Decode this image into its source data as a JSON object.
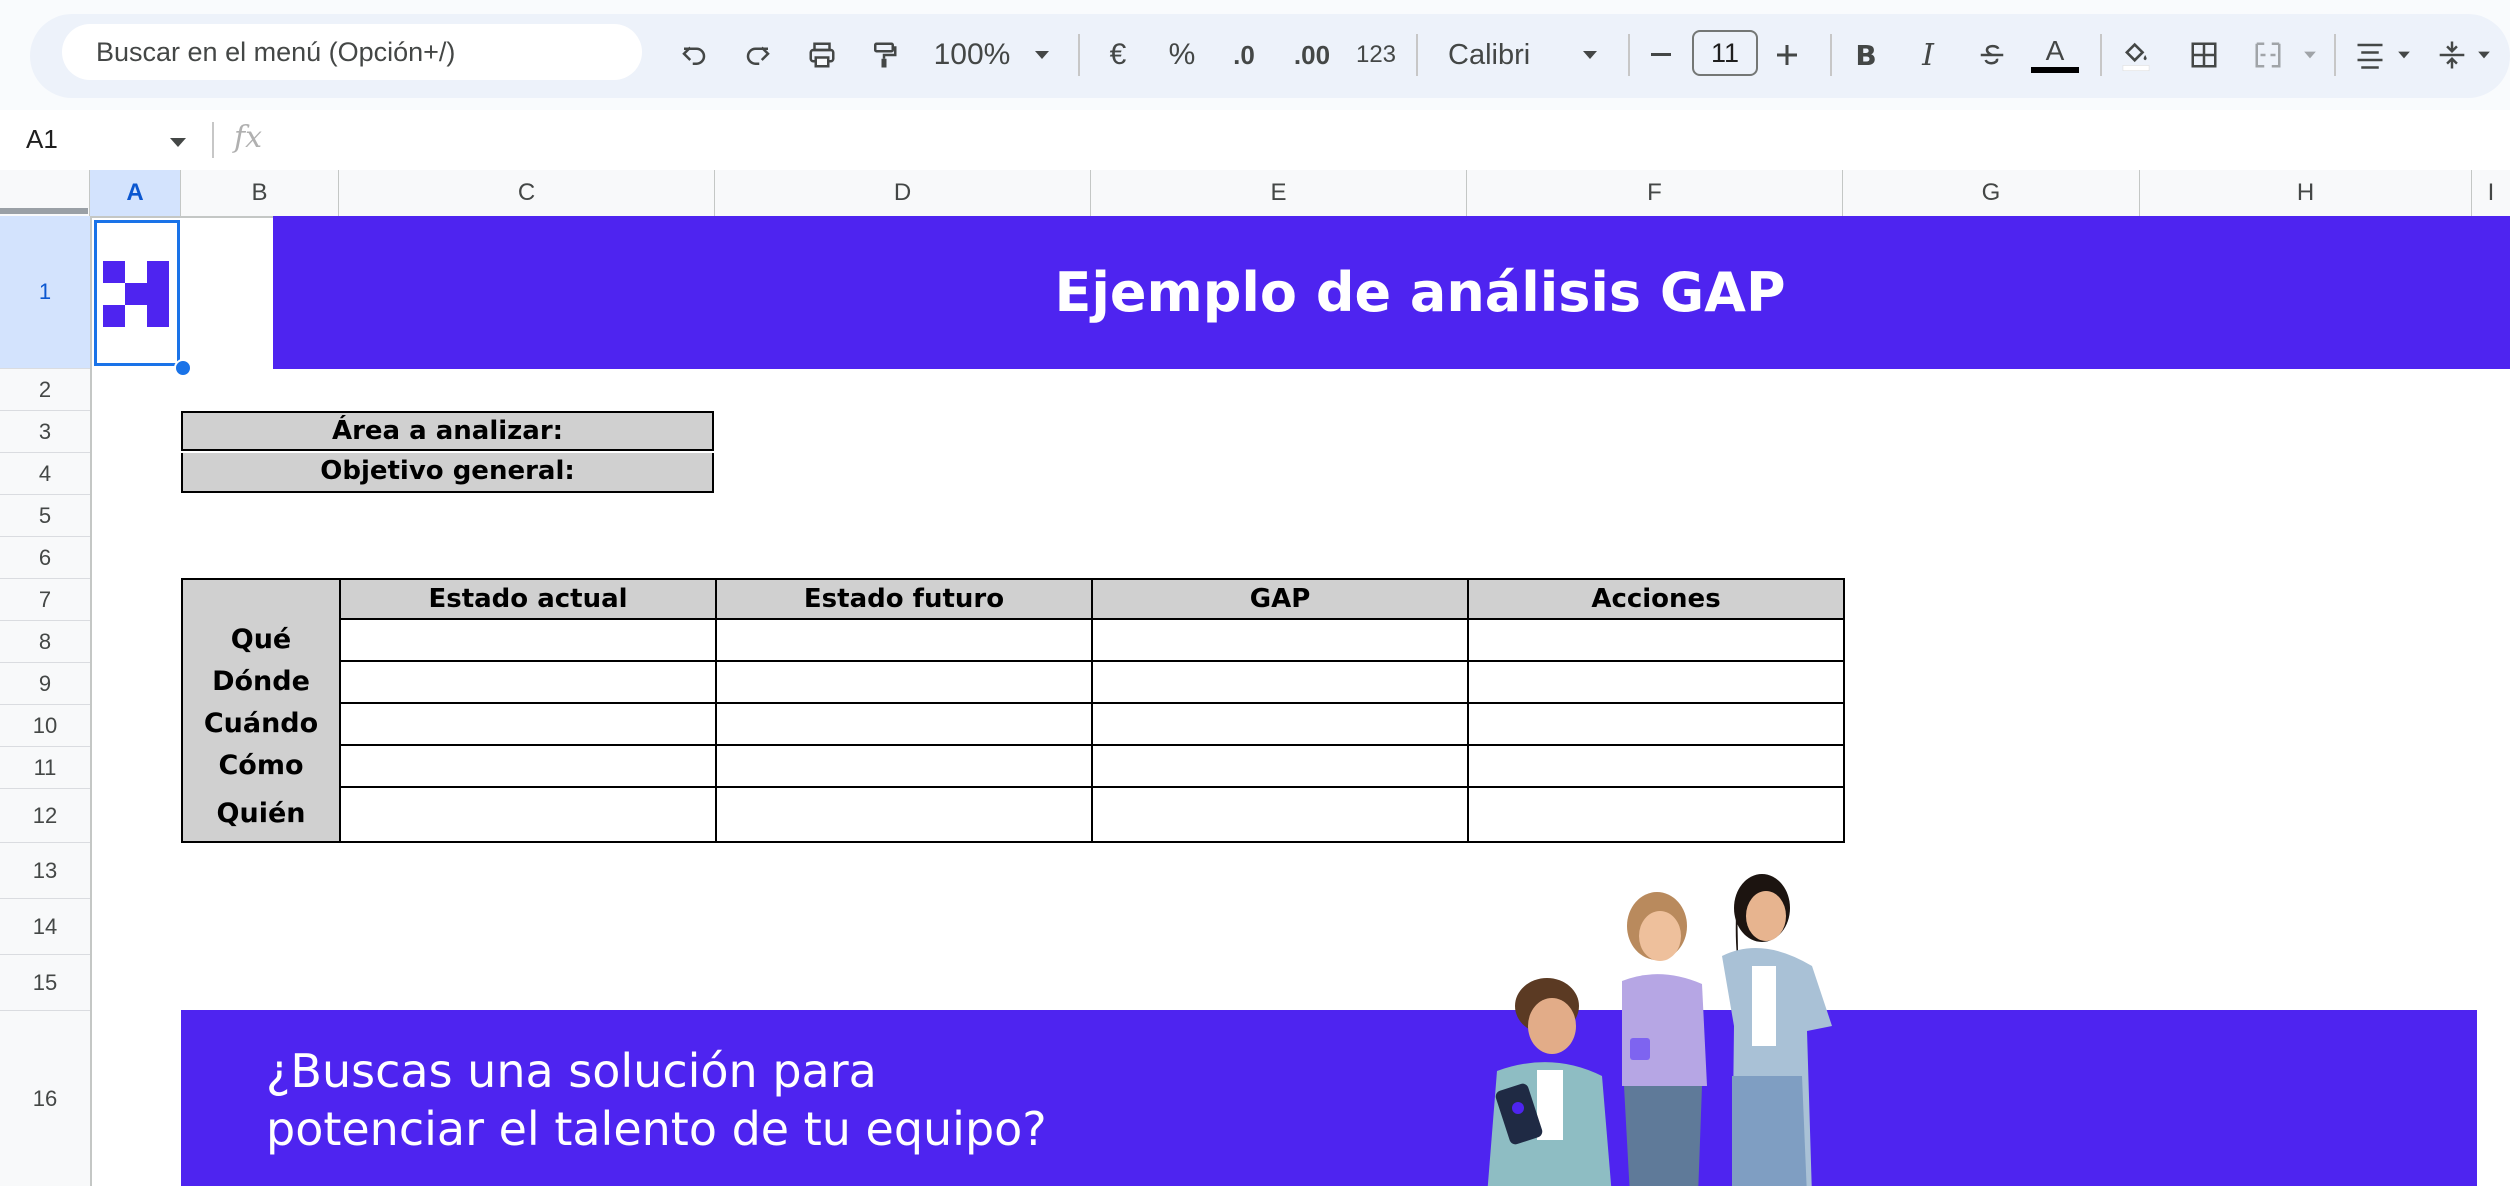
{
  "toolbar": {
    "search_placeholder": "Buscar en el menú (Opción+/)",
    "zoom": "100%",
    "currency_label": "€",
    "percent_label": "%",
    "decrease_decimals_label": ".0",
    "increase_decimals_label": ".00",
    "number_format_label": "123",
    "font_name": "Calibri",
    "font_size": "11"
  },
  "formula_bar": {
    "cell_ref": "A1",
    "fx_label": "fx"
  },
  "columns": [
    "A",
    "B",
    "C",
    "D",
    "E",
    "F",
    "G",
    "H",
    "I"
  ],
  "rows": [
    "1",
    "2",
    "3",
    "4",
    "5",
    "6",
    "7",
    "8",
    "9",
    "10",
    "11",
    "12",
    "13",
    "14",
    "15",
    "16"
  ],
  "sheet": {
    "title": "Ejemplo de análisis GAP",
    "area_label": "Área a analizar:",
    "objective_label": "Objetivo general:",
    "table_headers": [
      "Estado actual",
      "Estado futuro",
      "GAP",
      "Acciones"
    ],
    "row_labels": [
      "Qué",
      "Dónde",
      "Cuándo",
      "Cómo",
      "Quién"
    ],
    "cta_line1": "¿Buscas una solución para",
    "cta_line2": "potenciar el talento de tu equipo?"
  },
  "colors": {
    "brand": "#4e24f0",
    "header_fill": "#d0d0d0",
    "selection": "#1a73e8"
  },
  "icons": [
    "undo-icon",
    "redo-icon",
    "print-icon",
    "paint-format-icon",
    "bold-icon",
    "italic-icon",
    "strikethrough-icon",
    "text-color-icon",
    "fill-color-icon",
    "borders-icon",
    "merge-cells-icon",
    "align-icon",
    "vertical-align-icon"
  ]
}
